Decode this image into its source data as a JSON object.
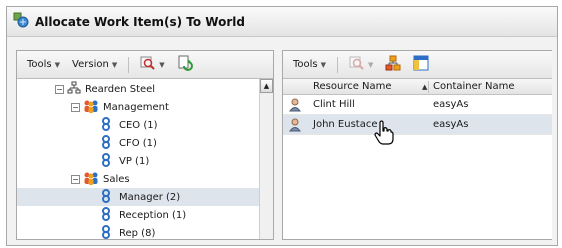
{
  "window": {
    "title": "Allocate Work Item(s) To World"
  },
  "left_panel": {
    "toolbar": {
      "tools_label": "Tools",
      "version_label": "Version"
    },
    "tree": [
      {
        "label": "Rearden Steel",
        "icon": "org-chart-icon",
        "expander": "minus",
        "level": 0
      },
      {
        "label": "Management",
        "icon": "group-icon",
        "expander": "minus",
        "level": 1
      },
      {
        "label": "CEO  (1)",
        "icon": "role-icon",
        "level": 2
      },
      {
        "label": "CFO  (1)",
        "icon": "role-icon",
        "level": 2
      },
      {
        "label": "VP  (1)",
        "icon": "role-icon",
        "level": 2
      },
      {
        "label": "Sales",
        "icon": "group-icon",
        "expander": "minus",
        "level": 1
      },
      {
        "label": "Manager  (2)",
        "icon": "role-icon",
        "level": 2,
        "selected": true
      },
      {
        "label": "Reception  (1)",
        "icon": "role-icon",
        "level": 2
      },
      {
        "label": "Rep  (8)",
        "icon": "role-icon",
        "level": 2
      }
    ]
  },
  "right_panel": {
    "toolbar": {
      "tools_label": "Tools"
    },
    "columns": {
      "resource": "Resource Name",
      "container": "Container Name"
    },
    "rows": [
      {
        "resource": "Clint Hill",
        "container": "easyAs",
        "selected": false
      },
      {
        "resource": "John Eustace",
        "container": "easyAs",
        "selected": true
      }
    ]
  },
  "colors": {
    "selection": "#dde4ec",
    "accent_orange": "#f0a020",
    "accent_blue": "#2d6fc4"
  }
}
